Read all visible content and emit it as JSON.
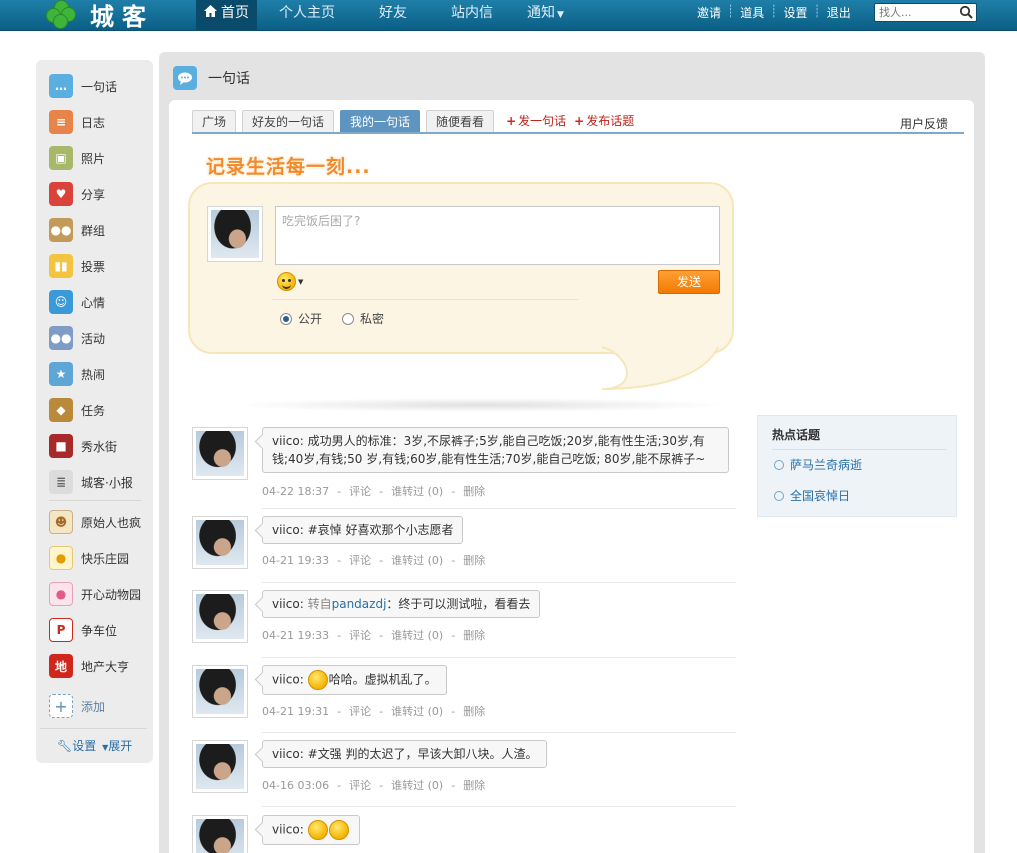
{
  "topbar": {
    "logo_text": "城客",
    "nav": [
      "首页",
      "个人主页",
      "好友",
      "站内信",
      "通知"
    ],
    "links": [
      "邀请",
      "道具",
      "设置",
      "退出"
    ],
    "search_placeholder": "找人..."
  },
  "sidebar": {
    "items": [
      {
        "label": "一句话",
        "icon": "speech-bubble-icon"
      },
      {
        "label": "日志",
        "icon": "notepad-icon"
      },
      {
        "label": "照片",
        "icon": "photo-icon"
      },
      {
        "label": "分享",
        "icon": "heart-icon"
      },
      {
        "label": "群组",
        "icon": "group-icon"
      },
      {
        "label": "投票",
        "icon": "poll-icon"
      },
      {
        "label": "心情",
        "icon": "smiley-icon"
      },
      {
        "label": "活动",
        "icon": "event-icon"
      },
      {
        "label": "热闹",
        "icon": "runner-icon"
      },
      {
        "label": "任务",
        "icon": "task-icon"
      },
      {
        "label": "秀水街",
        "icon": "shop-icon"
      },
      {
        "label": "城客·小报",
        "icon": "newspaper-icon"
      },
      {
        "label": "原始人也疯",
        "icon": "caveman-icon"
      },
      {
        "label": "快乐庄园",
        "icon": "chick-icon"
      },
      {
        "label": "开心动物园",
        "icon": "pig-icon"
      },
      {
        "label": "争车位",
        "icon": "parking-icon"
      },
      {
        "label": "地产大亨",
        "icon": "property-icon"
      }
    ],
    "add_label": "添加",
    "footer_settings": "设置",
    "footer_expand": "展开"
  },
  "panel": {
    "title": "一句话",
    "tabs": [
      "广场",
      "好友的一句话",
      "我的一句话",
      "随便看看"
    ],
    "active_tab": "我的一句话",
    "tab_links": [
      "发一句话",
      "发布话题"
    ],
    "feedback": "用户反馈"
  },
  "compose": {
    "slogan": "记录生活每一刻...",
    "placeholder": "吃完饭后困了?",
    "send_label": "发送",
    "privacy_public": "公开",
    "privacy_private": "私密"
  },
  "posts": [
    {
      "user": "viico:",
      "text": "成功男人的标准：3岁,不尿裤子;5岁,能自己吃饭;20岁,能有性生活;30岁,有",
      "text2": "钱;40岁,有钱;50 岁,有钱;60岁,能有性生活;70岁,能自己吃饭; 80岁,能不尿裤子~",
      "time": "04-22 18:37"
    },
    {
      "user": "viico:",
      "text": "#哀悼 好喜欢那个小志愿者",
      "time": "04-21 19:33"
    },
    {
      "user": "viico:",
      "prefix": "转自",
      "link": "pandazdj",
      "text": "：终于可以测试啦，看看去",
      "time": "04-21 19:33"
    },
    {
      "user": "viico:",
      "text": "哈哈。虚拟机乱了。",
      "time": "04-21 19:31"
    },
    {
      "user": "viico:",
      "text": "#文强 判的太迟了，早该大卸八块。人渣。",
      "time": "04-16 03:06"
    },
    {
      "user": "viico:",
      "text": "",
      "time": ""
    }
  ],
  "post_actions": {
    "comment": "评论",
    "forwarded": "谁转过 (0)",
    "delete": "删除"
  },
  "hot_topics": {
    "title": "热点话题",
    "items": [
      "萨马兰奇病逝",
      "全国哀悼日"
    ]
  }
}
